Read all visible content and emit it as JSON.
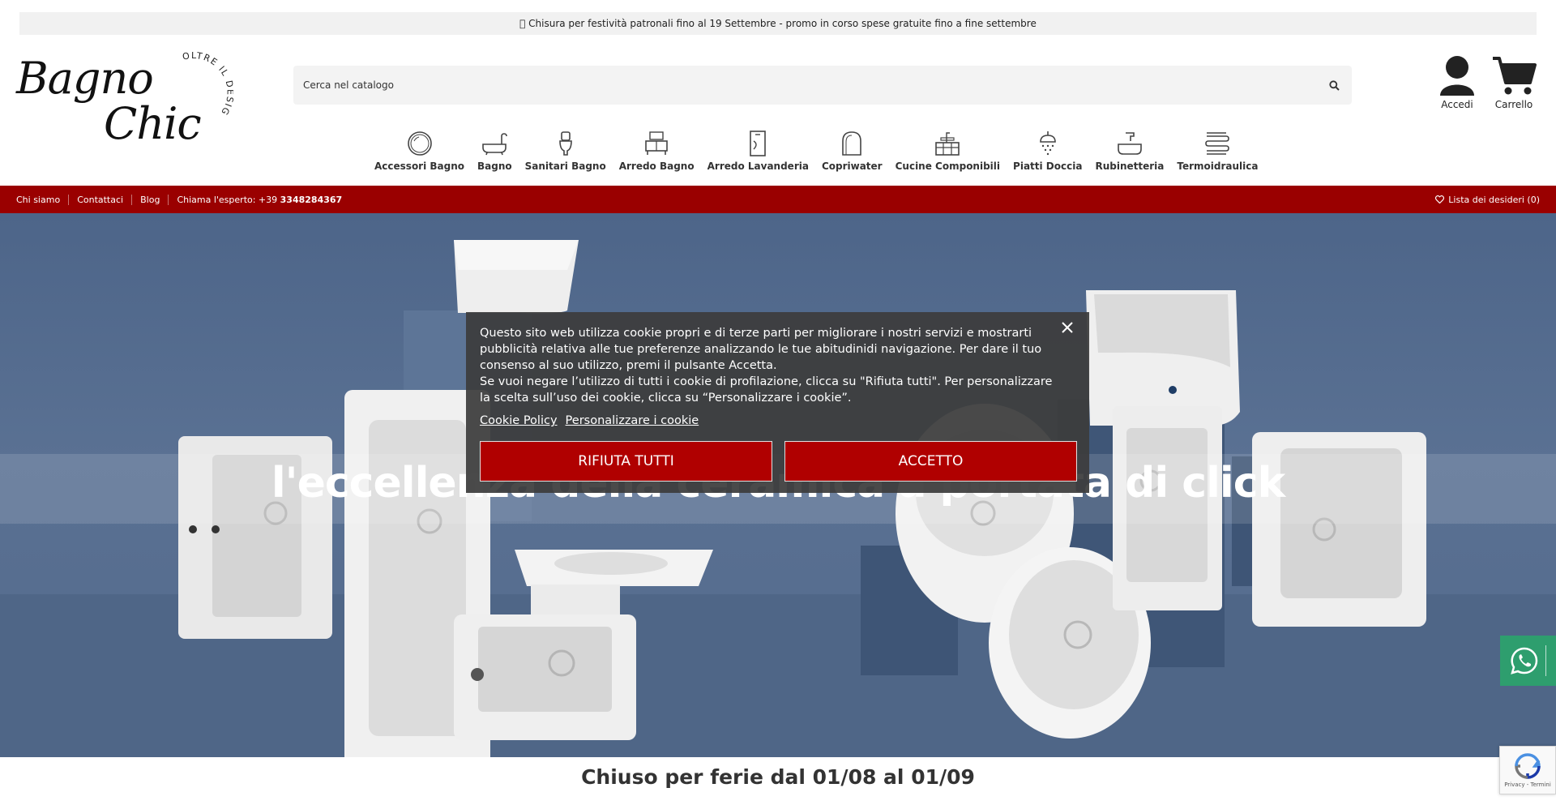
{
  "announcement": " Chisura per festività patronali fino al 19 Settembre - promo in corso spese gratuite fino a fine settembre",
  "logo": {
    "line1": "Bagno",
    "line2": "Chic",
    "tagline": "OLTRE IL DESIGN"
  },
  "search": {
    "placeholder": "Cerca nel catalogo"
  },
  "header": {
    "login_label": "Accedi",
    "cart_label": "Carrello"
  },
  "categories": [
    {
      "label": "Accessori Bagno",
      "icon": "mirror-icon"
    },
    {
      "label": "Bagno",
      "icon": "bathtub-icon"
    },
    {
      "label": "Sanitari Bagno",
      "icon": "toilet-icon"
    },
    {
      "label": "Arredo Bagno",
      "icon": "vanity-icon"
    },
    {
      "label": "Arredo Lavanderia",
      "icon": "laundry-icon"
    },
    {
      "label": "Copriwater",
      "icon": "toilet-seat-icon"
    },
    {
      "label": "Cucine Componibili",
      "icon": "kitchen-icon"
    },
    {
      "label": "Piatti Doccia",
      "icon": "shower-icon"
    },
    {
      "label": "Rubinetteria",
      "icon": "faucet-icon"
    },
    {
      "label": "Termoidraulica",
      "icon": "radiator-icon"
    }
  ],
  "topbar": {
    "links": [
      "Chi siamo",
      "Contattaci",
      "Blog"
    ],
    "phone_prefix": "Chiama l'esperto: +39 ",
    "phone_number": "3348284367",
    "wishlist": "Lista dei desideri (0)"
  },
  "hero": {
    "title": "l'eccellenza della ceramica a portata di click"
  },
  "cookie": {
    "text1": "Questo sito web utilizza cookie propri e di terze parti per migliorare i nostri servizi e mostrarti pubblicità relativa alle tue preferenze analizzando le tue abitudinidi navigazione. Per dare il tuo consenso al suo utilizzo, premi il pulsante Accetta.",
    "text2": "Se vuoi negare l’utilizzo di tutti i cookie di profilazione, clicca su \"Rifiuta tutti\". Per personalizzare la scelta sull’uso dei cookie, clicca su “Personalizzare i cookie”.",
    "policy_link": "Cookie Policy",
    "customize_link": "Personalizzare i cookie",
    "reject_label": "RIFIUTA TUTTI",
    "accept_label": "ACCETTO"
  },
  "closing_notice": "Chiuso per ferie dal 01/08 al 01/09",
  "recaptcha": {
    "text": "Privacy - Termini"
  },
  "colors": {
    "brand_red": "#9a0000",
    "button_red": "#b00000",
    "whatsapp": "#2e9e6e",
    "hero_blue": "#566d8f"
  }
}
